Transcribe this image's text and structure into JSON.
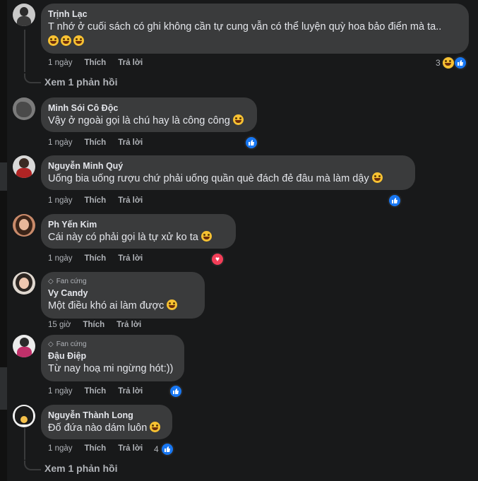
{
  "comments": [
    {
      "author": "Trịnh Lạc",
      "text": "T nhớ ở cuối sách có ghi không cần tự cung vẫn có thể luyện quỳ hoa bảo điển mà ta..",
      "emoji_line": "😂😂😂",
      "time": "1 ngày",
      "like": "Thích",
      "reply": "Trả lời",
      "reaction_count": "3",
      "view_replies": "Xem 1 phản hồi"
    },
    {
      "author": "Minh Sói Cô Độc",
      "text": "Vậy ở ngoài gọi là chú hay là công công",
      "time": "1 ngày",
      "like": "Thích",
      "reply": "Trả lời"
    },
    {
      "author": "Nguyễn Minh Quý",
      "text": "Uống bia uống rượu chứ phải uống quần què đách đẻ đâu mà làm dậy",
      "time": "1 ngày",
      "like": "Thích",
      "reply": "Trả lời"
    },
    {
      "author": "Ph Yến Kim",
      "text": "Cái này có phải gọi là tự xử ko ta",
      "time": "1 ngày",
      "like": "Thích",
      "reply": "Trả lời"
    },
    {
      "badge": "Fan cứng",
      "author": "Vy Candy",
      "text": "Một điều khó ai làm được",
      "time": "15 giờ",
      "like": "Thích",
      "reply": "Trả lời"
    },
    {
      "badge": "Fan cứng",
      "author": "Đậu Điệp",
      "text": "Từ nay hoạ mi ngừng hót:))",
      "time": "1 ngày",
      "like": "Thích",
      "reply": "Trả lời"
    },
    {
      "author": "Nguyễn Thành Long",
      "text": "Đố đứa nào dám luôn",
      "time": "1 ngày",
      "like": "Thích",
      "reply": "Trả lời",
      "reaction_count": "4",
      "view_replies": "Xem 1 phản hồi"
    }
  ],
  "colors": {
    "background": "#18191a",
    "bubble": "#3a3b3c",
    "like_blue": "#1877f2",
    "heart_red": "#f33e58"
  },
  "icons": {
    "like": "thumbs-up-icon",
    "heart": "heart-icon",
    "laugh": "laughing-emoji-icon",
    "badge": "diamond-icon"
  }
}
